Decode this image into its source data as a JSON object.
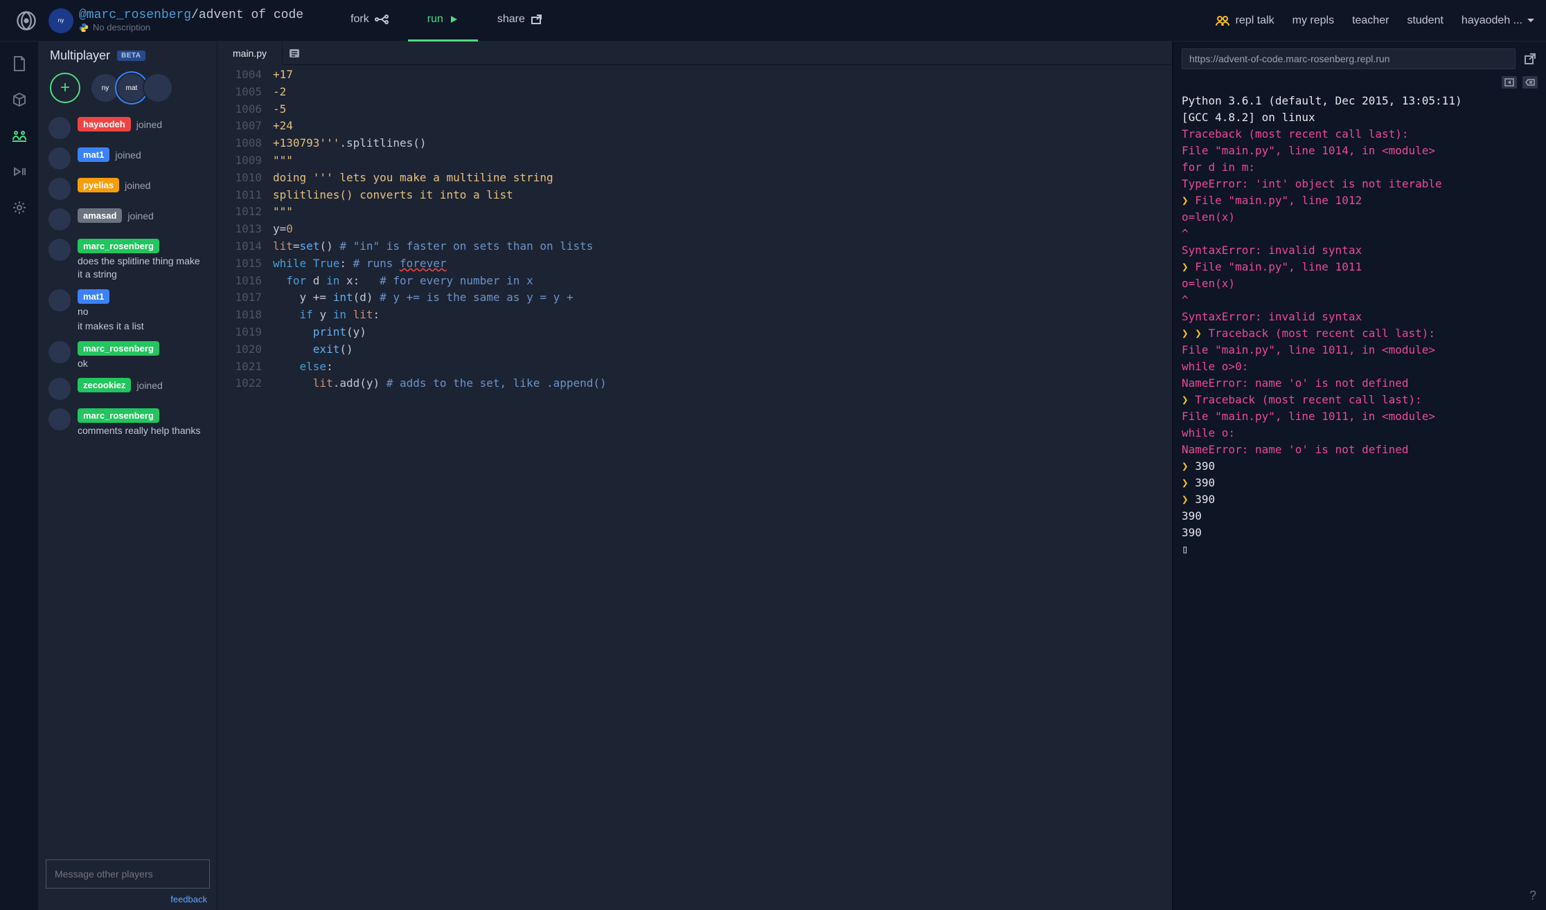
{
  "header": {
    "owner_handle": "@marc_rosenberg",
    "project_name": "/advent of code",
    "no_description": "No description",
    "actions": {
      "fork": "fork",
      "run": "run",
      "share": "share"
    },
    "right_nav": {
      "repl_talk": "repl talk",
      "my_repls": "my repls",
      "teacher": "teacher",
      "student": "student",
      "username": "hayaodeh ..."
    }
  },
  "sidebar": {
    "title": "Multiplayer",
    "beta": "BETA",
    "feed": [
      {
        "name": "hayaodeh",
        "color": "red",
        "joined": true
      },
      {
        "name": "mat1",
        "color": "blue",
        "joined": true
      },
      {
        "name": "pyelias",
        "color": "orange",
        "joined": true
      },
      {
        "name": "amasad",
        "color": "gray",
        "joined": true
      },
      {
        "name": "marc_rosenberg",
        "color": "green",
        "joined": false,
        "msg": "does the splitline thing make it a string"
      },
      {
        "name": "mat1",
        "color": "blue",
        "joined": false,
        "msg": "no\nit makes it a list"
      },
      {
        "name": "marc_rosenberg",
        "color": "green",
        "joined": false,
        "msg": "ok"
      },
      {
        "name": "zecookiez",
        "color": "green",
        "joined": true
      },
      {
        "name": "marc_rosenberg",
        "color": "green",
        "joined": false,
        "msg": "comments really help thanks"
      }
    ],
    "joined_suffix": "joined",
    "input_placeholder": "Message other players",
    "feedback": "feedback"
  },
  "editor": {
    "tab": "main.py",
    "lines": [
      {
        "n": 1004,
        "frags": [
          [
            "str",
            "+17"
          ]
        ]
      },
      {
        "n": 1005,
        "frags": [
          [
            "str",
            "-2"
          ]
        ]
      },
      {
        "n": 1006,
        "frags": [
          [
            "str",
            "-5"
          ]
        ]
      },
      {
        "n": 1007,
        "frags": [
          [
            "str",
            "+24"
          ]
        ]
      },
      {
        "n": 1008,
        "frags": [
          [
            "str",
            "+130793'''"
          ],
          [
            "plain",
            ".splitlines()"
          ]
        ]
      },
      {
        "n": 1009,
        "frags": [
          [
            "str",
            "\"\"\""
          ]
        ]
      },
      {
        "n": 1010,
        "frags": [
          [
            "str",
            "doing ''' lets you make a multiline string"
          ]
        ]
      },
      {
        "n": 1011,
        "frags": [
          [
            "str",
            "splitlines() converts it into a list"
          ]
        ]
      },
      {
        "n": 1012,
        "frags": [
          [
            "str",
            "\"\"\""
          ]
        ]
      },
      {
        "n": 1013,
        "frags": [
          [
            "plain",
            "y="
          ],
          [
            "num",
            "0"
          ]
        ]
      },
      {
        "n": 1014,
        "frags": [
          [
            "id",
            "lit"
          ],
          [
            "plain",
            "="
          ],
          [
            "fn",
            "set"
          ],
          [
            "plain",
            "() "
          ],
          [
            "cmt",
            "# \"in\" is faster on sets than on lists"
          ]
        ]
      },
      {
        "n": 1015,
        "frags": [
          [
            "kw",
            "while "
          ],
          [
            "bool",
            "True"
          ],
          [
            "plain",
            ": "
          ],
          [
            "cmt",
            "# runs "
          ],
          [
            "err",
            "forever"
          ]
        ]
      },
      {
        "n": 1016,
        "frags": [
          [
            "plain",
            "  "
          ],
          [
            "kw",
            "for "
          ],
          [
            "plain",
            "d "
          ],
          [
            "kw",
            "in "
          ],
          [
            "plain",
            "x:   "
          ],
          [
            "cmt",
            "# for every number in x"
          ]
        ]
      },
      {
        "n": 1017,
        "frags": [
          [
            "plain",
            "    y += "
          ],
          [
            "fn",
            "int"
          ],
          [
            "plain",
            "(d) "
          ],
          [
            "cmt",
            "# y += is the same as y = y +"
          ]
        ]
      },
      {
        "n": 1018,
        "frags": [
          [
            "plain",
            "    "
          ],
          [
            "kw",
            "if "
          ],
          [
            "plain",
            "y "
          ],
          [
            "kw",
            "in "
          ],
          [
            "id",
            "lit"
          ],
          [
            "plain",
            ":"
          ]
        ]
      },
      {
        "n": 1019,
        "frags": [
          [
            "plain",
            "      "
          ],
          [
            "fn",
            "print"
          ],
          [
            "plain",
            "(y)"
          ]
        ]
      },
      {
        "n": 1020,
        "frags": [
          [
            "plain",
            "      "
          ],
          [
            "fn",
            "exit"
          ],
          [
            "plain",
            "()"
          ]
        ]
      },
      {
        "n": 1021,
        "frags": [
          [
            "plain",
            "    "
          ],
          [
            "kw",
            "else"
          ],
          [
            "plain",
            ":"
          ]
        ]
      },
      {
        "n": 1022,
        "frags": [
          [
            "plain",
            "      "
          ],
          [
            "id",
            "lit"
          ],
          [
            "plain",
            ".add(y) "
          ],
          [
            "cmt",
            "# adds to the set, like .append()"
          ]
        ]
      }
    ]
  },
  "console": {
    "url": "https://advent-of-code.marc-rosenberg.repl.run",
    "lines": [
      {
        "cls": "plain",
        "t": "Python 3.6.1 (default, Dec 2015, 13:05:11)"
      },
      {
        "cls": "plain",
        "t": "[GCC 4.8.2] on linux"
      },
      {
        "cls": "err",
        "t": "Traceback (most recent call last):"
      },
      {
        "cls": "err",
        "t": "  File \"main.py\", line 1014, in <module>"
      },
      {
        "cls": "err",
        "t": "    for d in m:"
      },
      {
        "cls": "err",
        "t": "TypeError: 'int' object is not iterable"
      },
      {
        "cls": "err",
        "prompt": true,
        "t": "  File \"main.py\", line 1012"
      },
      {
        "cls": "err",
        "t": "    o=len(x)"
      },
      {
        "cls": "err",
        "t": "    ^"
      },
      {
        "cls": "err",
        "t": "SyntaxError: invalid syntax"
      },
      {
        "cls": "err",
        "prompt": true,
        "t": "  File \"main.py\", line 1011"
      },
      {
        "cls": "err",
        "t": "    o=len(x)"
      },
      {
        "cls": "err",
        "t": "    ^"
      },
      {
        "cls": "err",
        "t": "SyntaxError: invalid syntax"
      },
      {
        "cls": "err",
        "prompt": true,
        "prompt2": true,
        "t": "Traceback (most recent call last):"
      },
      {
        "cls": "err",
        "t": "  File \"main.py\", line 1011, in <module>"
      },
      {
        "cls": "err",
        "t": "    while o>0:"
      },
      {
        "cls": "err",
        "t": "NameError: name 'o' is not defined"
      },
      {
        "cls": "err",
        "prompt": true,
        "t": "Traceback (most recent call last):"
      },
      {
        "cls": "err",
        "t": "  File \"main.py\", line 1011, in <module>"
      },
      {
        "cls": "err",
        "t": "    while o:"
      },
      {
        "cls": "err",
        "t": "NameError: name 'o' is not defined"
      },
      {
        "cls": "plain",
        "prompt": true,
        "t": "390"
      },
      {
        "cls": "plain",
        "prompt": true,
        "t": "390"
      },
      {
        "cls": "plain",
        "prompt": true,
        "t": "390"
      },
      {
        "cls": "plain",
        "t": "390"
      },
      {
        "cls": "plain",
        "t": "390"
      },
      {
        "cls": "plain",
        "t": "▯"
      }
    ]
  }
}
